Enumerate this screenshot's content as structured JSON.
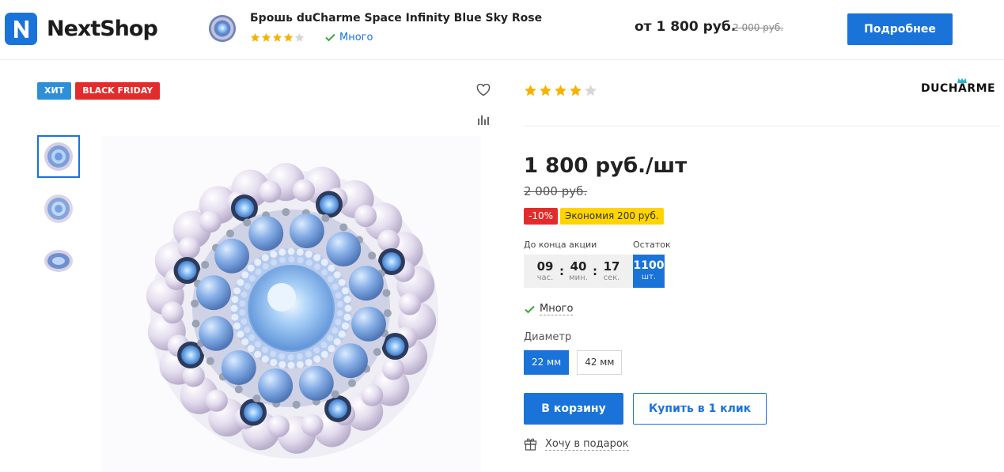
{
  "header": {
    "brand": "NextShop",
    "product_title": "Брошь duCharme Space Infinity Blue Sky Rose",
    "rating": 4,
    "stock_text": "Много",
    "price": "от 1 800 руб.",
    "old_price": "2 000 руб.",
    "details_label": "Подробнее"
  },
  "gallery": {
    "badges": [
      "ХИТ",
      "BLACK FRIDAY"
    ],
    "thumbnails": 3,
    "active_thumbnail": 1
  },
  "product": {
    "rating": 4,
    "brand": "DUCHARME",
    "price": "1 800 руб./шт",
    "old_price": "2 000 руб.",
    "discount": "-10%",
    "savings": "Экономия 200 руб.",
    "timer_label": "До конца акции",
    "timer": [
      {
        "value": "09",
        "unit": "час."
      },
      {
        "value": "40",
        "unit": "мин."
      },
      {
        "value": "17",
        "unit": "сек."
      }
    ],
    "stock_label": "Остаток",
    "stock_value": "1100",
    "stock_unit": "шт.",
    "availability": "Много",
    "size_label": "Диаметр",
    "sizes": [
      "22 мм",
      "42 мм"
    ],
    "selected_size": "22 мм",
    "cart_label": "В корзину",
    "one_click_label": "Купить в 1 клик",
    "gift_label": "Хочу в подарок"
  },
  "colors": {
    "accent": "#1a73d9",
    "sale_red": "#e32b2b",
    "hit_blue": "#2e8fd8",
    "savings_yellow": "#ffd400",
    "star": "#f5b300",
    "in_stock_green": "#3aa53a"
  },
  "icons": [
    "logo-n-icon",
    "check-icon",
    "heart-icon",
    "compare-chart-icon",
    "gift-icon",
    "star-icon"
  ]
}
